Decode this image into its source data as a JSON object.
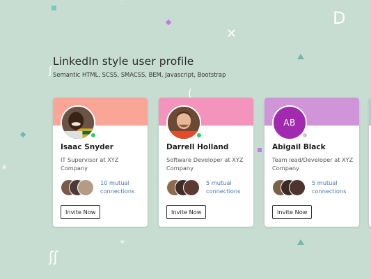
{
  "page": {
    "title": "LinkedIn style user profile",
    "subtitle": "Semantic HTML, SCSS, SMACSS, BEM, Javascript, Bootstrap"
  },
  "colors": {
    "background": "#c7ddd2",
    "online": "#2ecc71",
    "offline": "#c9c9d3",
    "link": "#3f7bb0"
  },
  "cards": [
    {
      "name": "Isaac Snyder",
      "job": "IT Supervisor at XYZ Company",
      "header_color": "#fba597",
      "avatar_icon": "man-photo-avatar",
      "status": "online",
      "mutual": "10 mutual connections",
      "invite_label": "Invite Now"
    },
    {
      "name": "Darrell Holland",
      "job": "Software Developer at XYZ Company",
      "header_color": "#f493bb",
      "avatar_icon": "man-photo-avatar",
      "status": "online",
      "mutual": "5 mutual connections",
      "invite_label": "Invite Now"
    },
    {
      "name": "Abigail Black",
      "job": "Team lead/Developer at XYZ Company",
      "header_color": "#cf95d8",
      "avatar_initials": "AB",
      "avatar_color": "#a22ab0",
      "status": "offline",
      "mutual": "5 mutual connections",
      "invite_label": "Invite Now"
    }
  ]
}
